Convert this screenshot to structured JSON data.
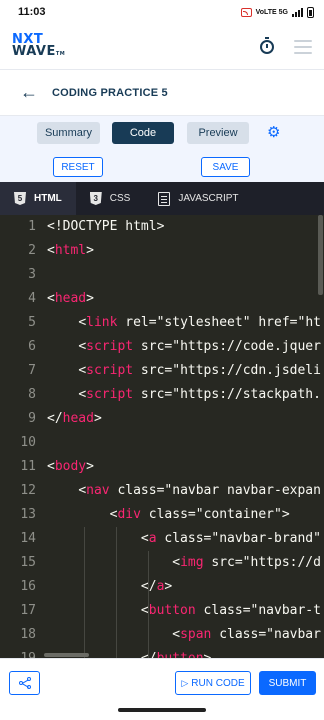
{
  "status_bar": {
    "time": "11:03",
    "network_label": "VoLTE 5G"
  },
  "header": {
    "logo_line1": "NXT",
    "logo_line2": "WAVE",
    "logo_tm": "TM"
  },
  "title_row": {
    "back_icon": "arrow-left-icon",
    "title": "CODING PRACTICE 5"
  },
  "tabs": [
    {
      "label": "Summary",
      "active": false
    },
    {
      "label": "Code",
      "active": true
    },
    {
      "label": "Preview",
      "active": false
    }
  ],
  "actions": {
    "reset_label": "RESET",
    "save_label": "SAVE"
  },
  "editor_tabs": [
    {
      "label": "HTML",
      "icon": "html5-icon",
      "active": true
    },
    {
      "label": "CSS",
      "icon": "css3-icon",
      "active": false
    },
    {
      "label": "JAVASCRIPT",
      "icon": "js-file-icon",
      "active": false
    }
  ],
  "code_lines": [
    {
      "n": "1",
      "text": "<!DOCTYPE html>"
    },
    {
      "n": "2",
      "text": "<html>"
    },
    {
      "n": "3",
      "text": ""
    },
    {
      "n": "4",
      "text": "<head>"
    },
    {
      "n": "5",
      "text": "    <link rel=\"stylesheet\" href=\"ht"
    },
    {
      "n": "6",
      "text": "    <script src=\"https://code.jquer"
    },
    {
      "n": "7",
      "text": "    <script src=\"https://cdn.jsdeli"
    },
    {
      "n": "8",
      "text": "    <script src=\"https://stackpath."
    },
    {
      "n": "9",
      "text": "</head>"
    },
    {
      "n": "10",
      "text": ""
    },
    {
      "n": "11",
      "text": "<body>"
    },
    {
      "n": "12",
      "text": "    <nav class=\"navbar navbar-expan"
    },
    {
      "n": "13",
      "text": "        <div class=\"container\">"
    },
    {
      "n": "14",
      "text": "            <a class=\"navbar-brand\""
    },
    {
      "n": "15",
      "text": "                <img src=\"https://d"
    },
    {
      "n": "16",
      "text": "            </a>"
    },
    {
      "n": "17",
      "text": "            <button class=\"navbar-t"
    },
    {
      "n": "18",
      "text": "                <span class=\"navbar"
    },
    {
      "n": "19",
      "text": "            </button>"
    }
  ],
  "bottom_bar": {
    "run_label": "RUN CODE",
    "submit_label": "SUBMIT"
  },
  "colors": {
    "accent": "#0b69ff",
    "navy": "#183b56",
    "editor_bg": "#272822",
    "tag": "#f92672",
    "attr": "#a6e22e",
    "string": "#e6db74"
  }
}
